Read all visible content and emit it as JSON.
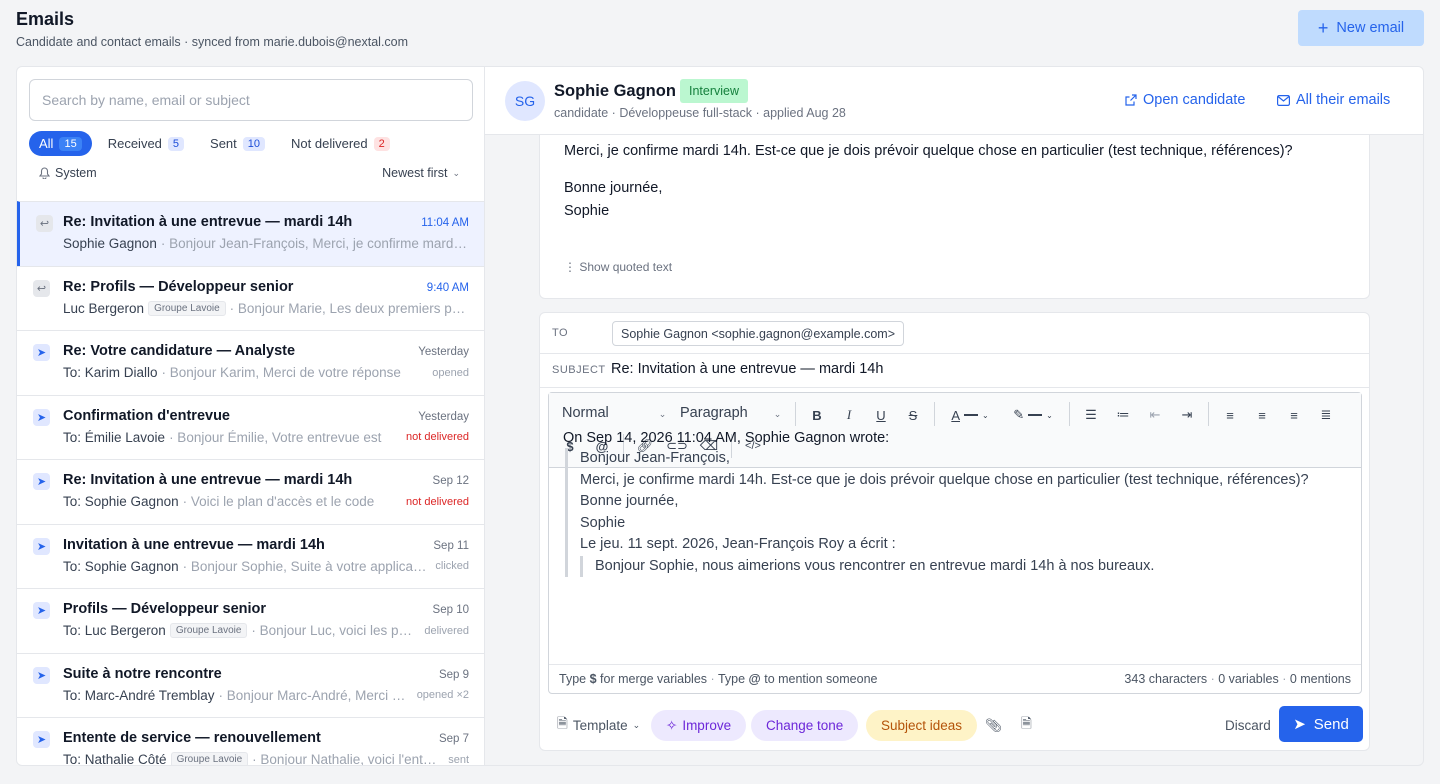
{
  "header": {
    "title": "Emails",
    "subtitle": "Candidate and contact emails · synced from marie.dubois@nextal.com",
    "new_button": "New email"
  },
  "search": {
    "placeholder": "Search by name, email or subject"
  },
  "filters": [
    {
      "label": "All",
      "count": "15"
    },
    {
      "label": "Received",
      "count": "5"
    },
    {
      "label": "Sent",
      "count": "10"
    },
    {
      "label": "Not delivered",
      "count": "2"
    }
  ],
  "system_label": "System",
  "sort_label": "Newest first",
  "emails": [
    {
      "subject": "Re: Invitation à une entrevue — mardi 14h",
      "time": "11:04 AM",
      "who": "Sophie Gagnon",
      "tag": "",
      "preview": "· Bonjour Jean-François, Merci, je confirme mardi 14h",
      "status": ""
    },
    {
      "subject": "Re: Profils — Développeur senior",
      "time": "9:40 AM",
      "who": "Luc Bergeron",
      "tag": "Groupe Lavoie",
      "preview": "· Bonjour Marie, Les deux premiers profils",
      "status": ""
    },
    {
      "subject": "Re: Votre candidature — Analyste",
      "time": "Yesterday",
      "who": "To: Karim Diallo",
      "tag": "",
      "preview": "· Bonjour Karim, Merci de votre réponse",
      "status": "opened"
    },
    {
      "subject": "Confirmation d'entrevue",
      "time": "Yesterday",
      "who": "To: Émilie Lavoie",
      "tag": "",
      "preview": "· Bonjour Émilie, Votre entrevue est",
      "status": "not delivered"
    },
    {
      "subject": "Re: Invitation à une entrevue — mardi 14h",
      "time": "Sep 12",
      "who": "To: Sophie Gagnon",
      "tag": "",
      "preview": "· Voici le plan d'accès et le code",
      "status": "not delivered"
    },
    {
      "subject": "Invitation à une entrevue — mardi 14h",
      "time": "Sep 11",
      "who": "To: Sophie Gagnon",
      "tag": "",
      "preview": "· Bonjour Sophie, Suite à votre application",
      "status": "clicked"
    },
    {
      "subject": "Profils — Développeur senior",
      "time": "Sep 10",
      "who": "To: Luc Bergeron",
      "tag": "Groupe Lavoie",
      "preview": "· Bonjour Luc, voici les profils",
      "status": "delivered"
    },
    {
      "subject": "Suite à notre rencontre",
      "time": "Sep 9",
      "who": "To: Marc-André Tremblay",
      "tag": "",
      "preview": "· Bonjour Marc-André, Merci pour",
      "status": "opened ×2"
    },
    {
      "subject": "Entente de service — renouvellement",
      "time": "Sep 7",
      "who": "To: Nathalie Côté",
      "tag": "Groupe Lavoie",
      "preview": "· Bonjour Nathalie, voici l'entente",
      "status": "sent"
    }
  ],
  "contact": {
    "initials": "SG",
    "name": "Sophie Gagnon",
    "badge": "Interview",
    "meta": "candidate · Développeuse full-stack · applied Aug 28",
    "open_link": "Open candidate",
    "all_link": "All their emails"
  },
  "message": {
    "line1": "Merci, je confirme mardi 14h. Est-ce que je dois prévoir quelque chose en particulier (test technique, références)?",
    "line2": "Bonne journée,",
    "line3": "Sophie",
    "quoted": "Show quoted text"
  },
  "composer": {
    "to_label": "TO",
    "to_value": "Sophie Gagnon <sophie.gagnon@example.com>",
    "subject_label": "SUBJECT",
    "subject_value": "Re: Invitation à une entrevue — mardi 14h",
    "toolbar": {
      "style": "Normal",
      "block": "Paragraph"
    },
    "body_intro": "On Sep 14, 2026 11:04 AM, Sophie Gagnon wrote:",
    "quote": [
      "Bonjour Jean-François,",
      "Merci, je confirme mardi 14h. Est-ce que je dois prévoir quelque chose en particulier (test technique, références)?",
      "Bonne journée,",
      "Sophie",
      "Le jeu. 11 sept. 2026, Jean-François Roy a écrit :"
    ],
    "nested_quote": "Bonjour Sophie, nous aimerions vous rencontrer en entrevue mardi 14h à nos bureaux.",
    "hint1": "Type",
    "hint1b": "$",
    "hint1c": "for merge variables",
    "hint2": "Type",
    "hint2b": "@",
    "hint2c": "to mention someone",
    "chars": "343 characters",
    "vars": "0 variables",
    "mentions": "0 mentions"
  },
  "actions": {
    "template": "Template",
    "improve": "Improve",
    "tone": "Change tone",
    "ideas": "Subject ideas",
    "discard": "Discard",
    "send": "Send"
  }
}
